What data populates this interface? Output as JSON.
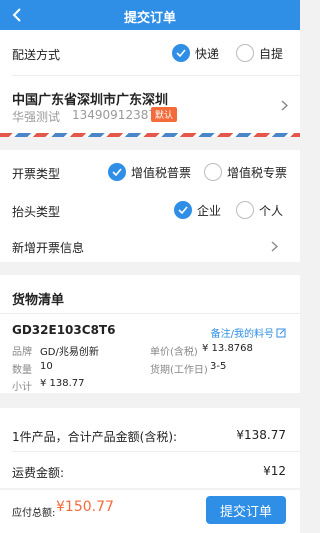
{
  "header": {
    "title": "提交订单"
  },
  "delivery": {
    "label": "配送方式",
    "options": [
      {
        "label": "快递",
        "selected": true
      },
      {
        "label": "自提",
        "selected": false
      }
    ]
  },
  "address": {
    "line": "中国广东省深圳市广东深圳",
    "name": "华强测试",
    "phone": "13490912387",
    "default_badge": "默认"
  },
  "invoice": {
    "type_label": "开票类型",
    "type_options": [
      {
        "label": "增值税普票",
        "selected": true
      },
      {
        "label": "增值税专票",
        "selected": false
      }
    ],
    "title_label": "抬头类型",
    "title_options": [
      {
        "label": "企业",
        "selected": true
      },
      {
        "label": "个人",
        "selected": false
      }
    ],
    "new_info_label": "新增开票信息"
  },
  "goods": {
    "section_title": "货物清单",
    "part_number": "GD32E103C8T6",
    "note_link": "备注/我的料号",
    "brand_label": "品牌",
    "brand_value": "GD/兆易创新",
    "unit_price_label": "单价(含税)",
    "unit_price_value": "¥ 13.8768",
    "qty_label": "数量",
    "qty_value": "10",
    "lead_time_label": "货期(工作日)",
    "lead_time_value": "3-5",
    "subtotal_label": "小计",
    "subtotal_value": "¥ 138.77"
  },
  "summary": {
    "products_label": "1件产品，合计产品金额(含税):",
    "products_value": "¥138.77",
    "shipping_label": "运费金额:",
    "shipping_value": "¥12"
  },
  "footer": {
    "total_label": "应付总额:",
    "total_value": "¥150.77",
    "submit_label": "提交订单"
  },
  "colors": {
    "accent": "#2f8fe6",
    "price": "#f36b3b",
    "badge": "#f36b3b"
  }
}
